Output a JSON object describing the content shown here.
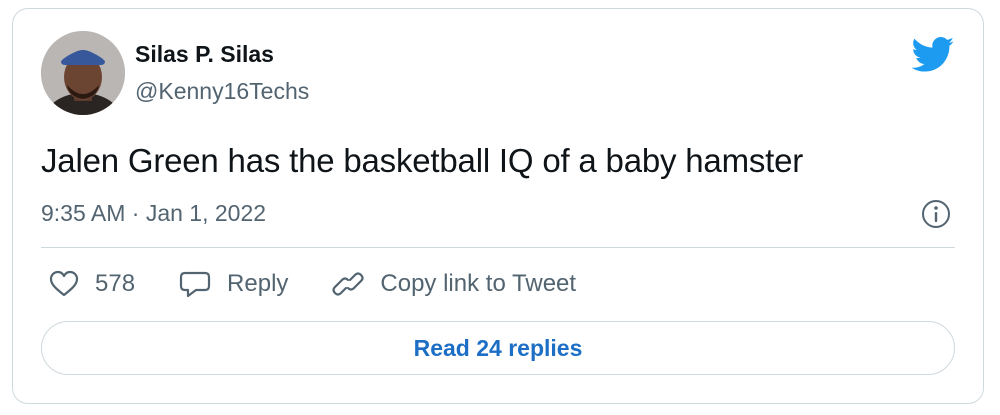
{
  "tweet": {
    "display_name": "Silas P. Silas",
    "handle": "@Kenny16Techs",
    "text": "Jalen Green has the basketball IQ of a baby hamster",
    "timestamp": "9:35 AM · Jan 1, 2022",
    "avatar_icon": "user-avatar",
    "logo_icon": "twitter-bird-icon",
    "logo_color": "#1d9bf0"
  },
  "actions": {
    "like_count": "578",
    "reply_label": "Reply",
    "copy_link_label": "Copy link to Tweet"
  },
  "read_replies_label": "Read 24 replies",
  "colors": {
    "text": "#0f1419",
    "secondary": "#536471",
    "border": "#cfd9de",
    "link": "#1d6fc6"
  }
}
